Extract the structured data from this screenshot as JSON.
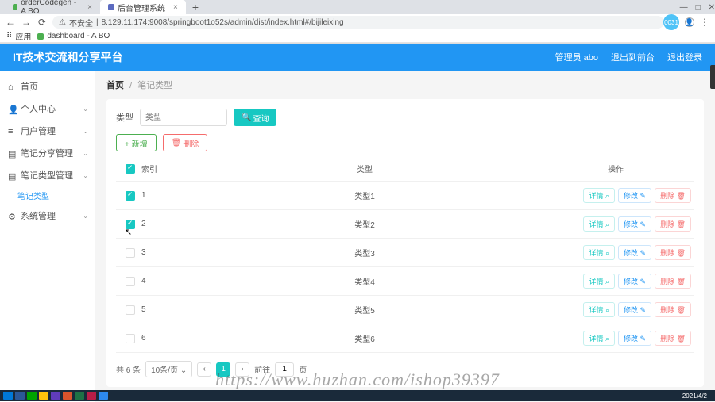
{
  "browser": {
    "tabs": [
      {
        "title": "orderCodegen - A BO"
      },
      {
        "title": "后台管理系统"
      }
    ],
    "url": "8.129.11.174:9008/springboot1o52s/admin/dist/index.html#/bijileixing",
    "insecure_label": "不安全",
    "bookmarks": {
      "apps": "应用",
      "dash": "dashboard - A BO"
    },
    "badge": "0031",
    "win": {
      "min": "—",
      "max": "□",
      "close": "✕"
    }
  },
  "header": {
    "title": "IT技术交流和分享平台",
    "admin_label": "管理员 abo",
    "frontend": "退出到前台",
    "logout": "退出登录"
  },
  "sidebar": {
    "items": [
      {
        "label": "首页",
        "icon": "home"
      },
      {
        "label": "个人中心",
        "icon": "user"
      },
      {
        "label": "用户管理",
        "icon": "list"
      },
      {
        "label": "笔记分享管理",
        "icon": "note"
      },
      {
        "label": "笔记类型管理",
        "icon": "tag"
      },
      {
        "label": "系统管理",
        "icon": "gear"
      }
    ],
    "sub_active": "笔记类型"
  },
  "breadcrumb": {
    "home": "首页",
    "current": "笔记类型"
  },
  "filter": {
    "label": "类型",
    "placeholder": "类型",
    "search_btn": "查询"
  },
  "actions": {
    "add": "+ 新增",
    "delete": "删除"
  },
  "table": {
    "headers": {
      "index": "索引",
      "type": "类型",
      "ops": "操作"
    },
    "rows": [
      {
        "checked": true,
        "index": "1",
        "type": "类型1"
      },
      {
        "checked": true,
        "index": "2",
        "type": "类型2"
      },
      {
        "checked": false,
        "index": "3",
        "type": "类型3"
      },
      {
        "checked": false,
        "index": "4",
        "type": "类型4"
      },
      {
        "checked": false,
        "index": "5",
        "type": "类型5"
      },
      {
        "checked": false,
        "index": "6",
        "type": "类型6"
      }
    ],
    "ops": {
      "view": "详情",
      "edit": "修改",
      "delete": "删除"
    }
  },
  "pager": {
    "total": "共 6 条",
    "page_size": "10条/页",
    "current": "1",
    "goto_label": "前往",
    "goto_value": "1",
    "page_suffix": "页"
  },
  "watermark": "https://www.huzhan.com/ishop39397",
  "taskbar": {
    "date": "2021/4/2"
  }
}
